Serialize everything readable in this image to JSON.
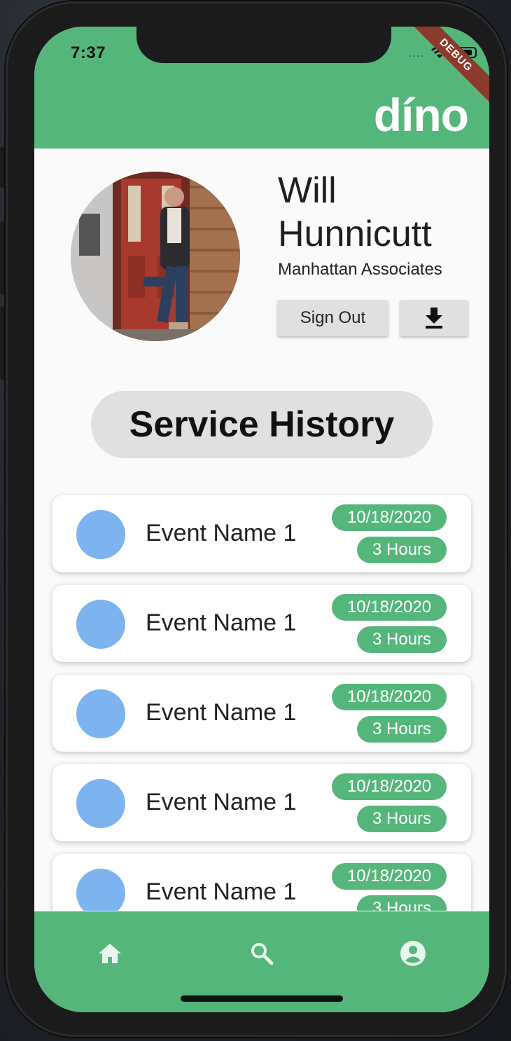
{
  "status_bar": {
    "time": "7:37",
    "signal_dots": "....",
    "debug_banner": "DEBUG"
  },
  "app_bar": {
    "logo": "díno"
  },
  "profile": {
    "first_name": "Will",
    "last_name": "Hunnicutt",
    "company": "Manhattan Associates",
    "sign_out_label": "Sign Out",
    "download_icon": "download-icon",
    "avatar": "profile-photo"
  },
  "section_title": "Service History",
  "events": [
    {
      "name": "Event Name 1",
      "date": "10/18/2020",
      "hours": "3 Hours"
    },
    {
      "name": "Event Name 1",
      "date": "10/18/2020",
      "hours": "3 Hours"
    },
    {
      "name": "Event Name 1",
      "date": "10/18/2020",
      "hours": "3 Hours"
    },
    {
      "name": "Event Name 1",
      "date": "10/18/2020",
      "hours": "3 Hours"
    },
    {
      "name": "Event Name 1",
      "date": "10/18/2020",
      "hours": "3 Hours"
    }
  ],
  "bottom_nav": [
    {
      "icon": "home-icon"
    },
    {
      "icon": "search-icon"
    },
    {
      "icon": "account-circle-icon"
    }
  ],
  "colors": {
    "brand_green": "#55b67b",
    "event_circle": "#7db3ef",
    "button_grey": "#e0e0e0",
    "debug_banner": "#8b3a2b"
  }
}
